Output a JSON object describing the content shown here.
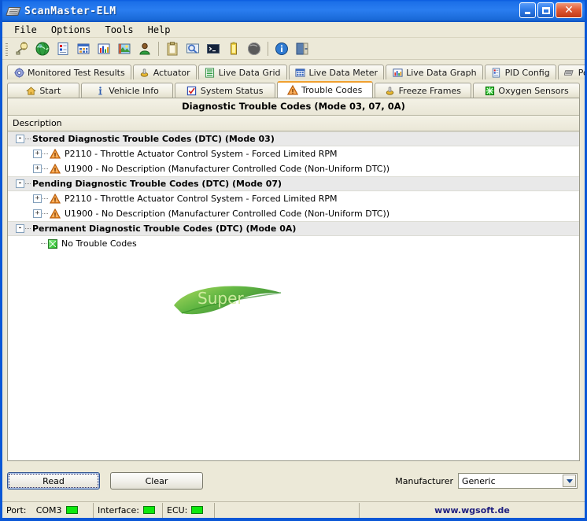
{
  "window": {
    "title": "ScanMaster-ELM",
    "icon": "chip-icon",
    "controls": {
      "minimize": "minimize-button",
      "maximize": "maximize-button",
      "close": "close-button"
    }
  },
  "menubar": {
    "items": [
      {
        "label": "File"
      },
      {
        "label": "Options"
      },
      {
        "label": "Tools"
      },
      {
        "label": "Help"
      }
    ]
  },
  "toolbar": {
    "buttons": [
      {
        "name": "connect-icon"
      },
      {
        "name": "globe-icon"
      },
      {
        "name": "report-icon"
      },
      {
        "name": "grid-icon"
      },
      {
        "name": "chart-icon"
      },
      {
        "name": "image-icon"
      },
      {
        "name": "user-icon"
      },
      {
        "name": "clipboard-icon"
      },
      {
        "name": "monitor-search-icon"
      },
      {
        "name": "terminal-icon"
      },
      {
        "name": "battery-icon"
      },
      {
        "name": "disc-icon"
      },
      {
        "name": "info-icon"
      },
      {
        "name": "exit-icon"
      }
    ]
  },
  "tabs": {
    "row1": [
      {
        "label": "Monitored Test Results",
        "icon": "gear-blue-icon",
        "active": false
      },
      {
        "label": "Actuator",
        "icon": "actuator-icon",
        "active": false
      },
      {
        "label": "Live Data Grid",
        "icon": "list-green-icon",
        "active": false
      },
      {
        "label": "Live Data Meter",
        "icon": "meter-grid-icon",
        "active": false
      },
      {
        "label": "Live Data Graph",
        "icon": "bar-chart-icon",
        "active": false
      },
      {
        "label": "PID Config",
        "icon": "pid-doc-icon",
        "active": false
      },
      {
        "label": "Power",
        "icon": "chip-gray-icon",
        "active": false
      }
    ],
    "row2": [
      {
        "label": "Start",
        "icon": "home-icon",
        "active": false
      },
      {
        "label": "Vehicle Info",
        "icon": "info-blue-icon",
        "active": false
      },
      {
        "label": "System Status",
        "icon": "checkbox-red-icon",
        "active": false
      },
      {
        "label": "Trouble Codes",
        "icon": "warning-icon",
        "active": true
      },
      {
        "label": "Freeze Frames",
        "icon": "actuator-icon",
        "active": false
      },
      {
        "label": "Oxygen Sensors",
        "icon": "green-grid-icon",
        "active": false
      }
    ]
  },
  "panel": {
    "title": "Diagnostic Trouble Codes (Mode 03, 07, 0A)",
    "column_header": "Description",
    "watermark_text": "Super",
    "rows": [
      {
        "type": "group",
        "expander": "-",
        "label": "Stored Diagnostic Trouble Codes (DTC) (Mode 03)"
      },
      {
        "type": "child",
        "expander": "+",
        "icon": "warning-icon",
        "label": "P2110 - Throttle Actuator Control System - Forced Limited RPM"
      },
      {
        "type": "child",
        "expander": "+",
        "icon": "warning-icon",
        "label": "U1900 - No Description (Manufacturer Controlled Code (Non-Uniform DTC))"
      },
      {
        "type": "group",
        "expander": "-",
        "label": "Pending Diagnostic Trouble Codes (DTC) (Mode 07)"
      },
      {
        "type": "child",
        "expander": "+",
        "icon": "warning-icon",
        "label": "P2110 - Throttle Actuator Control System - Forced Limited RPM"
      },
      {
        "type": "child",
        "expander": "+",
        "icon": "warning-icon",
        "label": "U1900 - No Description (Manufacturer Controlled Code (Non-Uniform DTC))"
      },
      {
        "type": "group",
        "expander": "-",
        "label": "Permanent Diagnostic Trouble Codes (DTC) (Mode 0A)"
      },
      {
        "type": "leaf",
        "icon": "green-grid-icon",
        "label": "No Trouble Codes"
      }
    ]
  },
  "actions": {
    "read_label": "Read",
    "clear_label": "Clear",
    "manufacturer_label": "Manufacturer",
    "manufacturer_value": "Generic"
  },
  "statusbar": {
    "port_label": "Port:",
    "port_value": "COM3",
    "interface_label": "Interface:",
    "ecu_label": "ECU:",
    "website": "www.wgsoft.de"
  },
  "colors": {
    "titlebar_blue": "#1a6ad8",
    "window_border": "#0a57d6",
    "face": "#ece9d8",
    "active_tab_accent": "#f0a030",
    "led_green": "#0ee80e",
    "link_blue": "#202080"
  }
}
